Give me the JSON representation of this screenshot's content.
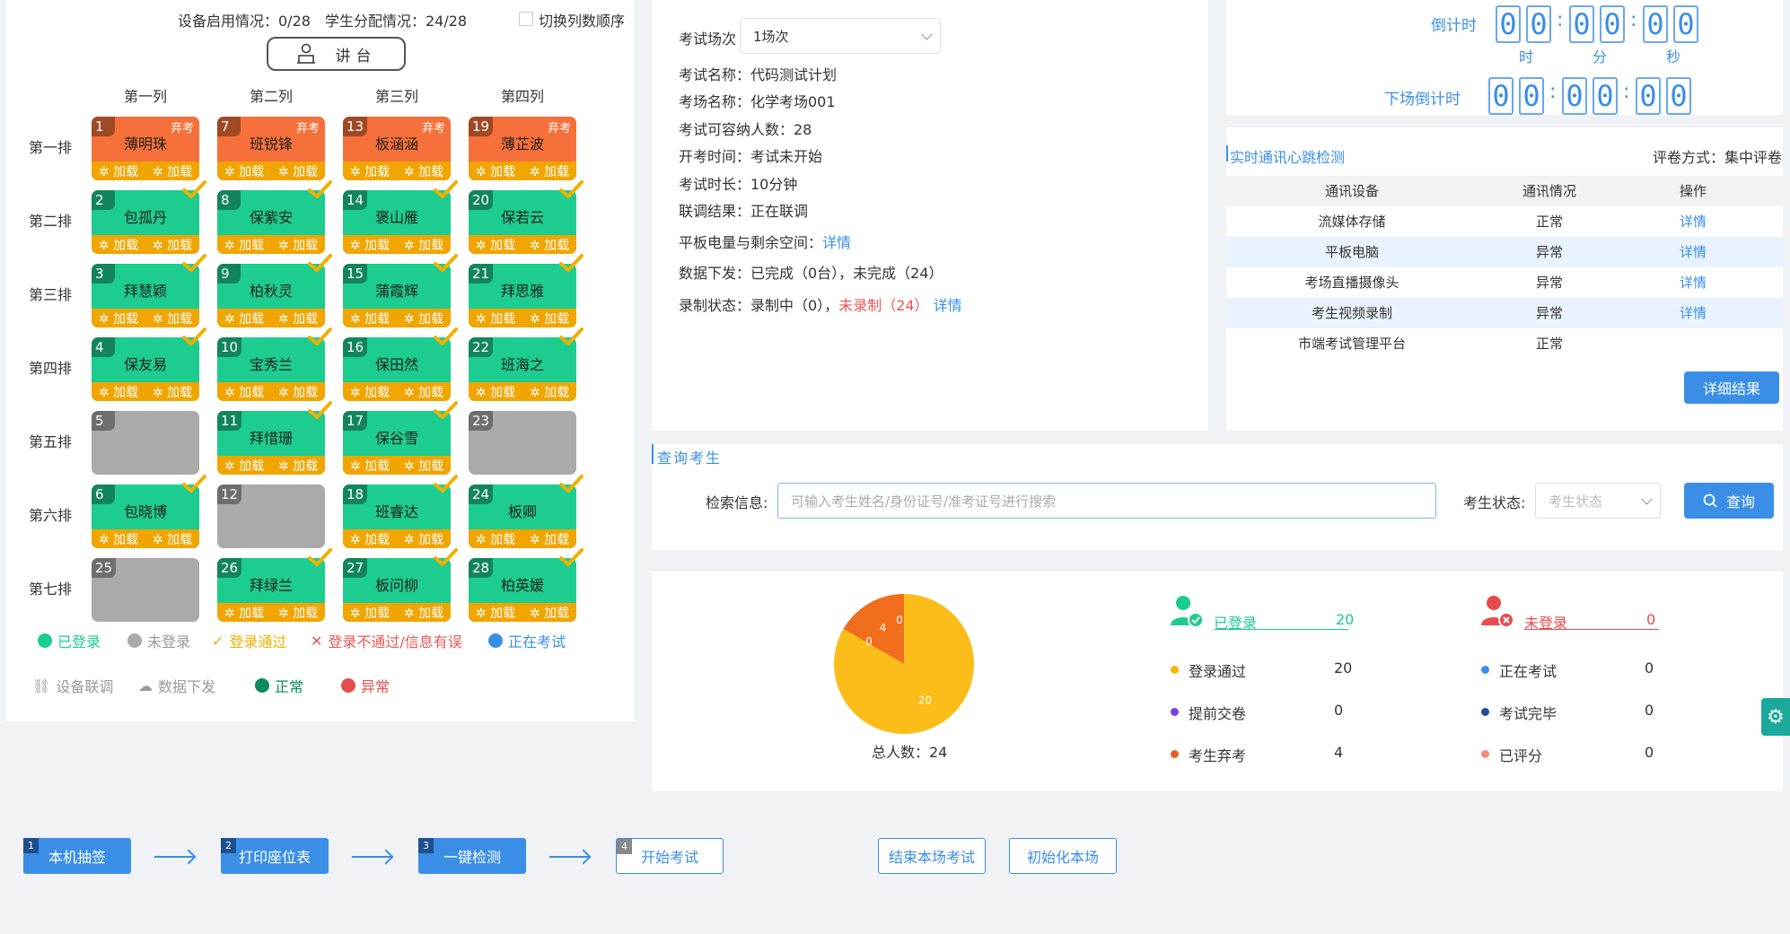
{
  "seat_header": {
    "device_status": "设备启用情况：0/28",
    "student_alloc": "学生分配情况：24/28",
    "toggle_label": "切换列数顺序",
    "podium": "讲台"
  },
  "columns": [
    "第一列",
    "第二列",
    "第三列",
    "第四列"
  ],
  "rows": [
    "第一排",
    "第二排",
    "第三排",
    "第四排",
    "第五排",
    "第六排",
    "第七排"
  ],
  "seat_bar": {
    "load": "加载"
  },
  "seats": [
    {
      "num": "1",
      "name": "薄明珠",
      "status": "orange",
      "tag": "弃考"
    },
    {
      "num": "7",
      "name": "班锐锋",
      "status": "orange",
      "tag": "弃考"
    },
    {
      "num": "13",
      "name": "板涵涵",
      "status": "orange",
      "tag": "弃考"
    },
    {
      "num": "19",
      "name": "薄芷波",
      "status": "orange",
      "tag": "弃考"
    },
    {
      "num": "2",
      "name": "包孤丹",
      "status": "green",
      "tag": ""
    },
    {
      "num": "8",
      "name": "保紫安",
      "status": "green",
      "tag": ""
    },
    {
      "num": "14",
      "name": "褒山雁",
      "status": "green",
      "tag": ""
    },
    {
      "num": "20",
      "name": "保若云",
      "status": "green",
      "tag": ""
    },
    {
      "num": "3",
      "name": "拜慧颖",
      "status": "green",
      "tag": ""
    },
    {
      "num": "9",
      "name": "柏秋灵",
      "status": "green",
      "tag": ""
    },
    {
      "num": "15",
      "name": "蒲霞辉",
      "status": "green",
      "tag": ""
    },
    {
      "num": "21",
      "name": "拜思雅",
      "status": "green",
      "tag": ""
    },
    {
      "num": "4",
      "name": "保友易",
      "status": "green",
      "tag": ""
    },
    {
      "num": "10",
      "name": "宝秀兰",
      "status": "green",
      "tag": ""
    },
    {
      "num": "16",
      "name": "保田然",
      "status": "green",
      "tag": ""
    },
    {
      "num": "22",
      "name": "班海之",
      "status": "green",
      "tag": ""
    },
    {
      "num": "5",
      "name": "",
      "status": "gray",
      "tag": ""
    },
    {
      "num": "11",
      "name": "拜惜珊",
      "status": "green",
      "tag": ""
    },
    {
      "num": "17",
      "name": "保谷雪",
      "status": "green",
      "tag": ""
    },
    {
      "num": "23",
      "name": "",
      "status": "gray",
      "tag": ""
    },
    {
      "num": "6",
      "name": "包晓博",
      "status": "green",
      "tag": ""
    },
    {
      "num": "12",
      "name": "",
      "status": "gray",
      "tag": ""
    },
    {
      "num": "18",
      "name": "班睿达",
      "status": "green",
      "tag": ""
    },
    {
      "num": "24",
      "name": "板卿",
      "status": "green",
      "tag": ""
    },
    {
      "num": "25",
      "name": "",
      "status": "gray",
      "tag": ""
    },
    {
      "num": "26",
      "name": "拜绿兰",
      "status": "green",
      "tag": ""
    },
    {
      "num": "27",
      "name": "板问柳",
      "status": "green",
      "tag": ""
    },
    {
      "num": "28",
      "name": "柏英媛",
      "status": "green",
      "tag": ""
    }
  ],
  "legend": {
    "logged_in": "已登录",
    "not_logged": "未登录",
    "login_pass": "登录通过",
    "login_fail": "登录不通过/信息有误",
    "examining": "正在考试",
    "device_debug": "设备联调",
    "data_dispatch": "数据下发",
    "normal": "正常",
    "abnormal": "异常"
  },
  "colors": {
    "orange": "#f5703a",
    "green": "#1dcc8f",
    "gray": "#aaaaaa",
    "bar": "#f0a500",
    "accent": "#3a8ee6"
  },
  "exam_info": {
    "session_label": "考试场次",
    "session_value": "1场次",
    "exam_name": "考试名称：代码测试计划",
    "room_name": "考场名称：化学考场001",
    "capacity": "考试可容纳人数：28",
    "start_time": "开考时间：考试未开始",
    "duration": "考试时长：10分钟",
    "debug_result": "联调结果：正在联调",
    "tablet_label": "平板电量与剩余空间：",
    "detail": "详情",
    "data_dispatch": "数据下发：已完成（0台），未完成（24）",
    "record_prefix": "录制状态：录制中（0），",
    "record_not": "未录制（24）"
  },
  "timer": {
    "countdown_label": "倒计时",
    "next_label": "下场倒计时",
    "hour": "时",
    "minute": "分",
    "second": "秒",
    "digits": [
      "0",
      "0",
      "0",
      "0",
      "0",
      "0"
    ],
    "next_digits": [
      "0",
      "0",
      "0",
      "0",
      "0",
      "0"
    ]
  },
  "heartbeat": {
    "title": "实时通讯心跳检测",
    "grading_mode": "评卷方式：集中评卷",
    "headers": [
      "通讯设备",
      "通讯情况",
      "操作"
    ],
    "rows": [
      {
        "device": "流媒体存储",
        "status": "正常",
        "action": "详情"
      },
      {
        "device": "平板电脑",
        "status": "异常",
        "action": "详情"
      },
      {
        "device": "考场直播摄像头",
        "status": "异常",
        "action": "详情"
      },
      {
        "device": "考生视频录制",
        "status": "异常",
        "action": "详情"
      },
      {
        "device": "市端考试管理平台",
        "status": "正常",
        "action": ""
      }
    ],
    "detail_button": "详细结果"
  },
  "search": {
    "title": "查询考生",
    "info_label": "检索信息:",
    "placeholder": "可输入考生姓名/身份证号/准考证号进行搜索",
    "status_label": "考生状态:",
    "status_placeholder": "考生状态",
    "button": "查询"
  },
  "stats": {
    "total": "总人数：24",
    "logged_label": "已登录",
    "logged_value": "20",
    "not_logged_label": "未登录",
    "not_logged_value": "0",
    "items_left": [
      {
        "label": "登录通过",
        "value": "20",
        "color": "#f5b800"
      },
      {
        "label": "提前交卷",
        "value": "0",
        "color": "#7b3fe4"
      },
      {
        "label": "考生弃考",
        "value": "4",
        "color": "#e0622a"
      }
    ],
    "items_right": [
      {
        "label": "正在考试",
        "value": "0",
        "color": "#3a8ee6"
      },
      {
        "label": "考试完毕",
        "value": "0",
        "color": "#1f4f8e"
      },
      {
        "label": "已评分",
        "value": "0",
        "color": "#f08a7e"
      }
    ]
  },
  "chart_data": {
    "type": "pie",
    "values": [
      20,
      4,
      0,
      0
    ],
    "labels": [
      "20",
      "4",
      "0",
      "0"
    ],
    "colors": [
      "#fbbd1a",
      "#f06e1c",
      "#7b3fe4",
      "#3a8ee6"
    ]
  },
  "steps": [
    {
      "num": "1",
      "label": "本机抽签"
    },
    {
      "num": "2",
      "label": "打印座位表"
    },
    {
      "num": "3",
      "label": "一键检测"
    },
    {
      "num": "4",
      "label": "开始考试"
    }
  ],
  "actions": {
    "end_exam": "结束本场考试",
    "init_room": "初始化本场"
  }
}
